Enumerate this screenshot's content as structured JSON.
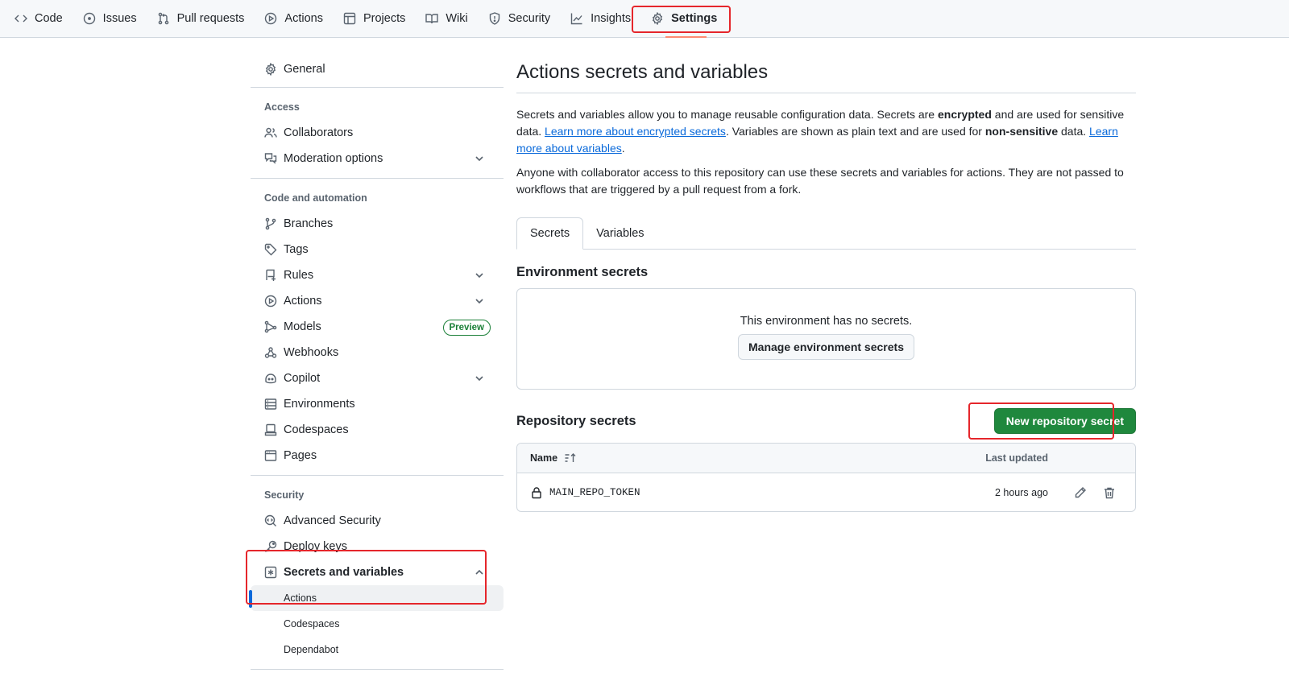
{
  "topnav": {
    "tabs": [
      {
        "label": "Code",
        "icon": "code-icon"
      },
      {
        "label": "Issues",
        "icon": "issue-opened-icon"
      },
      {
        "label": "Pull requests",
        "icon": "git-pull-request-icon"
      },
      {
        "label": "Actions",
        "icon": "play-icon"
      },
      {
        "label": "Projects",
        "icon": "table-icon"
      },
      {
        "label": "Wiki",
        "icon": "book-icon"
      },
      {
        "label": "Security",
        "icon": "shield-icon"
      },
      {
        "label": "Insights",
        "icon": "graph-icon"
      },
      {
        "label": "Settings",
        "icon": "gear-icon",
        "selected": true
      }
    ]
  },
  "sidebar": {
    "general": "General",
    "access_heading": "Access",
    "collaborators": "Collaborators",
    "moderation": "Moderation options",
    "code_heading": "Code and automation",
    "branches": "Branches",
    "tags": "Tags",
    "rules": "Rules",
    "actions": "Actions",
    "models": "Models",
    "models_badge": "Preview",
    "webhooks": "Webhooks",
    "copilot": "Copilot",
    "environments": "Environments",
    "codespaces": "Codespaces",
    "pages": "Pages",
    "security_heading": "Security",
    "advanced_security": "Advanced Security",
    "deploy_keys": "Deploy keys",
    "secrets_and_variables": "Secrets and variables",
    "sub_actions": "Actions",
    "sub_codespaces": "Codespaces",
    "sub_dependabot": "Dependabot"
  },
  "main": {
    "title": "Actions secrets and variables",
    "desc": {
      "p1": "Secrets and variables allow you to manage reusable configuration data. Secrets are ",
      "p1_bold": "encrypted",
      "p2": " and are used for sensitive data. ",
      "link1": "Learn more about encrypted secrets",
      "p3": ". Variables are shown as plain text and are used for ",
      "p3_bold": "non-sensitive",
      "p4": " data. ",
      "link2": "Learn more about variables",
      "p5": "."
    },
    "desc2": "Anyone with collaborator access to this repository can use these secrets and variables for actions. They are not passed to workflows that are triggered by a pull request from a fork.",
    "tabs": {
      "secrets": "Secrets",
      "variables": "Variables"
    },
    "env_heading": "Environment secrets",
    "env_empty": "This environment has no secrets.",
    "env_button": "Manage environment secrets",
    "repo_heading": "Repository secrets",
    "new_secret_button": "New repository secret",
    "table": {
      "col_name": "Name",
      "col_updated": "Last updated",
      "rows": [
        {
          "name": "MAIN_REPO_TOKEN",
          "updated": "2 hours ago"
        }
      ]
    }
  },
  "colors": {
    "accent_blue": "#0969da",
    "primary_green": "#1f883d",
    "selected_tab_underline": "#fd8c73",
    "annotation_red": "#e5262b"
  }
}
